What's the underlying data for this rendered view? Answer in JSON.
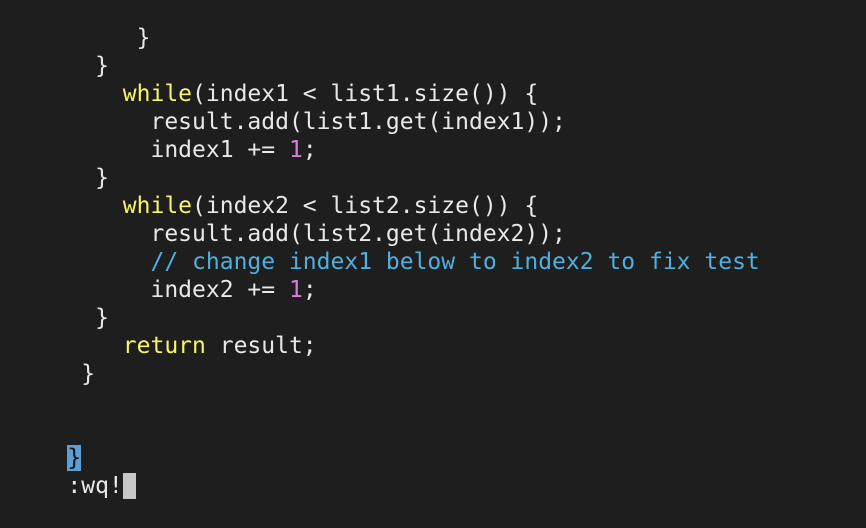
{
  "code": {
    "l1": "     }",
    "l2": "  }",
    "l3_kw": "while",
    "l3_rest": "(index1 < list1.size()) {",
    "l4": "result.add(list1.get(index1));",
    "l5_a": "index1 += ",
    "l5_num": "1",
    "l5_b": ";",
    "l6": "  }",
    "l7_kw": "while",
    "l7_rest": "(index2 < list2.size()) {",
    "l8": "result.add(list2.get(index2));",
    "l9_comment": "// change index1 below to index2 to fix test",
    "l10_a": "index2 += ",
    "l10_num": "1",
    "l10_b": ";",
    "l11": "  }",
    "l12_kw": "return",
    "l12_rest": " result;",
    "l13": " }",
    "l14_cursor_char": "}"
  },
  "command_line": {
    "text": ":wq!"
  },
  "colors": {
    "background": "#1e1e1e",
    "keyword": "#f5f569",
    "number": "#d77ddb",
    "comment": "#4fb0e0",
    "cursor": "#5b9fd6"
  }
}
